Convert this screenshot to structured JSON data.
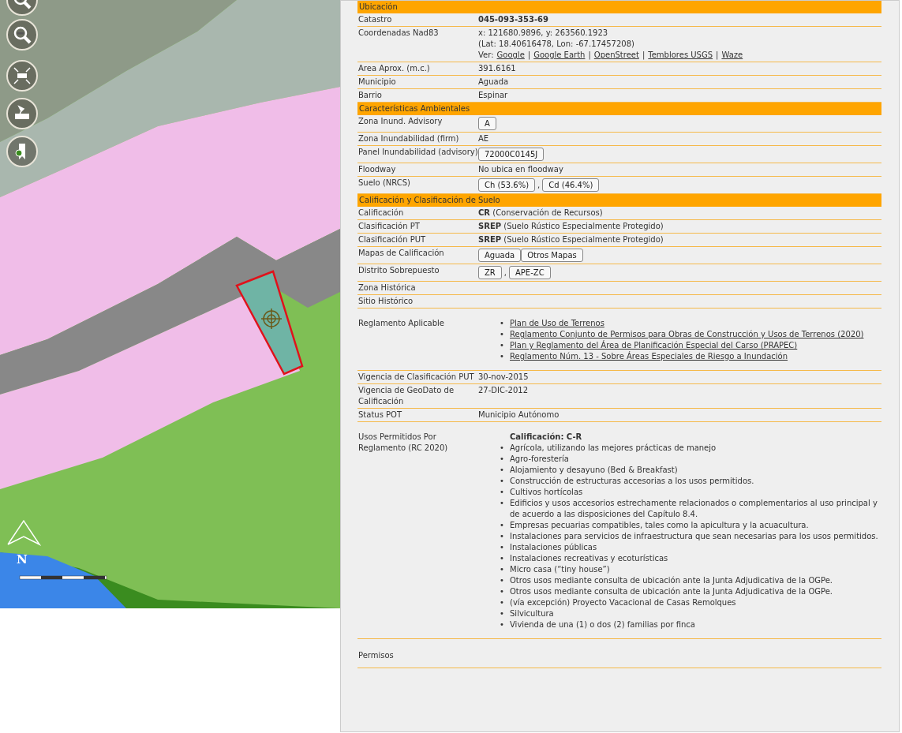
{
  "map": {
    "toolbar": [
      {
        "kind": "zoom-in"
      },
      {
        "kind": "zoom-out"
      },
      {
        "kind": "full-extent"
      },
      {
        "kind": "pin"
      },
      {
        "kind": "bookmark-add"
      }
    ],
    "north_label": "N"
  },
  "sections": [
    {
      "title": "Ubicación",
      "rows": [
        {
          "label": "Catastro",
          "kind": "bold",
          "value": "045-093-353-69"
        },
        {
          "label": "Coordenadas Nad83",
          "kind": "coords",
          "lines": [
            "x: 121680.9896, y: 263560.1923",
            "(Lat: 18.40616478, Lon: -67.17457208)"
          ],
          "links_label": "Ver:",
          "separator": "|",
          "links": [
            "Google",
            "Google Earth",
            "OpenStreet",
            "Temblores USGS",
            "Waze"
          ]
        },
        {
          "label": "Area Aprox. (m.c.)",
          "kind": "text",
          "value": "391.6161"
        },
        {
          "label": "Municipio",
          "kind": "text",
          "value": "Aguada"
        },
        {
          "label": "Barrio",
          "kind": "text",
          "value": "Espinar"
        }
      ]
    },
    {
      "title": "Características Ambientales",
      "rows": [
        {
          "label": "Zona Inund. Advisory",
          "kind": "chips",
          "chips": [
            "A"
          ]
        },
        {
          "label": "Zona Inundabilidad (firm)",
          "kind": "text",
          "value": "AE"
        },
        {
          "label": "Panel Inundabilidad (advisory)",
          "kind": "chips",
          "chips": [
            "72000C0145J"
          ]
        },
        {
          "label": "Floodway",
          "kind": "text",
          "value": "No ubica en floodway"
        },
        {
          "label": "Suelo (NRCS)",
          "kind": "chips",
          "separator": ",",
          "chips": [
            "Ch (53.6%)",
            "Cd (46.4%)"
          ]
        }
      ]
    },
    {
      "title": "Calificación y Clasificación de Suelo",
      "rows": [
        {
          "label": "Calificación",
          "kind": "text",
          "value": "**CR** (Conservación de Recursos)"
        },
        {
          "label": "Clasificación PT",
          "kind": "text",
          "value": "**SREP** (Suelo Rústico Especialmente Protegido)"
        },
        {
          "label": "Clasificación PUT",
          "kind": "text",
          "value": "**SREP** (Suelo Rústico Especialmente Protegido)"
        },
        {
          "label": "Mapas de Calificación",
          "kind": "chips",
          "chips": [
            "Aguada",
            "Otros Mapas"
          ]
        },
        {
          "label": "Distrito Sobrepuesto",
          "kind": "chips",
          "separator": ",",
          "chips": [
            "ZR",
            "APE-ZC"
          ]
        },
        {
          "label": "Zona Histórica",
          "kind": "empty"
        },
        {
          "label": "Sitio Histórico",
          "kind": "empty"
        },
        {
          "label": "Reglamento Aplicable",
          "kind": "links",
          "bullet": "•",
          "links": [
            "Plan de Uso de Terrenos",
            "Reglamento Conjunto de Permisos para Obras de Construcción y Usos de Terrenos (2020)",
            "Plan y Reglamento del Área de Planificación Especial del Carso (PRAPEC)",
            "Reglamento Núm. 13 - Sobre Áreas Especiales de Riesgo a Inundación"
          ]
        },
        {
          "label": "Vigencia de Clasificación PUT",
          "kind": "text",
          "value": "30-nov-2015"
        },
        {
          "label": "Vigencia de GeoDato de Calificación",
          "kind": "text",
          "value": "27-DIC-2012"
        },
        {
          "label": "Status POT",
          "kind": "text",
          "value": "Municipio Autónomo"
        },
        {
          "label": "Usos Permitidos Por Reglamento (RC 2020)",
          "kind": "uses",
          "heading": "Calificación: C-R",
          "bullet": "•",
          "items": [
            "Agrícola, utilizando las mejores prácticas de manejo",
            "Agro-forestería",
            "Alojamiento y desayuno (Bed & Breakfast)",
            "Construcción de estructuras accesorias a los usos permitidos.",
            "Cultivos hortícolas",
            "Edificios y usos accesorios estrechamente relacionados o complementarios al uso principal y de acuerdo a las disposiciones del Capítulo 8.4.",
            "Empresas pecuarias compatibles, tales como la apicultura y la acuacultura.",
            "Instalaciones para servicios de infraestructura que sean necesarias para los usos permitidos.",
            "Instalaciones públicas",
            "Instalaciones recreativas y ecoturísticas",
            "Micro casa (“tiny house”)",
            "Otros usos mediante consulta de ubicación ante la Junta Adjudicativa de la OGPe.",
            "Otros usos mediante consulta de ubicación ante la Junta Adjudicativa de la OGPe.",
            "(vía excepción) Proyecto Vacacional de Casas Remolques",
            "Silvicultura",
            "Vivienda de una (1) o dos (2) familias por finca"
          ]
        },
        {
          "label": "Permisos",
          "kind": "tall"
        }
      ]
    }
  ]
}
